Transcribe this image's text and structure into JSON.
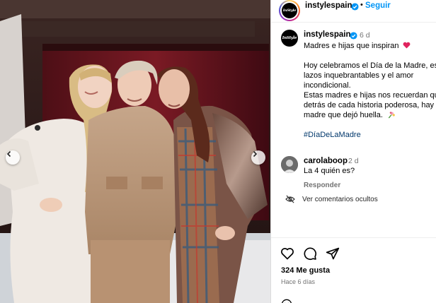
{
  "colors": {
    "accent": "#0095f6",
    "verified": "#0095f6",
    "hashtag": "#00376b",
    "muted": "#737373",
    "heart": "#e0245e"
  },
  "post": {
    "avatar_text": "InStyle",
    "username": "instylespain",
    "follow_label": "Seguir",
    "time": "6 d",
    "caption_title": "Madres e hijas que inspiran",
    "caption_line1": "Hoy celebramos el Día de la Madre, es",
    "caption_line2": "lazos inquebrantables y el amor",
    "caption_line3": "incondicional.",
    "caption_line4": "Estas madres e hijas nos recuerdan qu",
    "caption_line5": "detrás de cada historia poderosa, hay",
    "caption_line6": "madre que dejó huella.",
    "hashtag": "#DíaDeLaMadre"
  },
  "comment": {
    "username": "carolaboop",
    "time": "2 d",
    "text": "La 4 quién es?",
    "reply_label": "Responder"
  },
  "hidden_comments_label": "Ver comentarios ocultos",
  "likes_label": "324 Me gusta",
  "posted_ago": "Hace 6 días",
  "icons": [
    "verified-icon",
    "more-icon",
    "heart-icon",
    "comment-icon",
    "share-icon",
    "eye-off-icon",
    "emoji-icon",
    "chevron-left-icon",
    "chevron-right-icon"
  ]
}
